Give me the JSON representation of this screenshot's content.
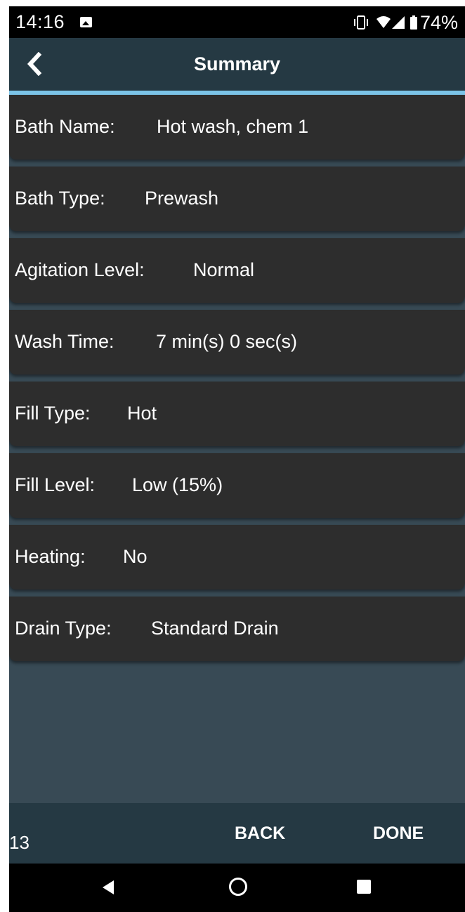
{
  "status_bar": {
    "time": "14:16",
    "battery_pct": "74%",
    "icons": [
      "image-icon",
      "vibrate-icon",
      "wifi-icon",
      "signal-icon",
      "battery-icon"
    ]
  },
  "header": {
    "title": "Summary",
    "back_icon": "chevron-left-icon"
  },
  "summary": {
    "items": [
      {
        "label": "Bath Name:",
        "value": "Hot wash, chem 1"
      },
      {
        "label": "Bath Type:",
        "value": "Prewash"
      },
      {
        "label": "Agitation Level:",
        "value": "Normal"
      },
      {
        "label": "Wash Time:",
        "value": "7 min(s) 0 sec(s)"
      },
      {
        "label": "Fill Type:",
        "value": "Hot"
      },
      {
        "label": "Fill Level:",
        "value": "Low (15%)"
      },
      {
        "label": "Heating:",
        "value": "No"
      },
      {
        "label": "Drain Type:",
        "value": "Standard Drain"
      }
    ]
  },
  "footer": {
    "step_number": "13",
    "back_label": "BACK",
    "done_label": "DONE"
  },
  "nav_bar": {
    "icons": [
      "nav-back-icon",
      "nav-home-icon",
      "nav-recents-icon"
    ]
  },
  "colors": {
    "status_bar": "#000000",
    "app_bar": "#253943",
    "accent_line": "#7cc4e8",
    "card": "#2d2d2d",
    "background": "#384a55",
    "text": "#ffffff"
  }
}
